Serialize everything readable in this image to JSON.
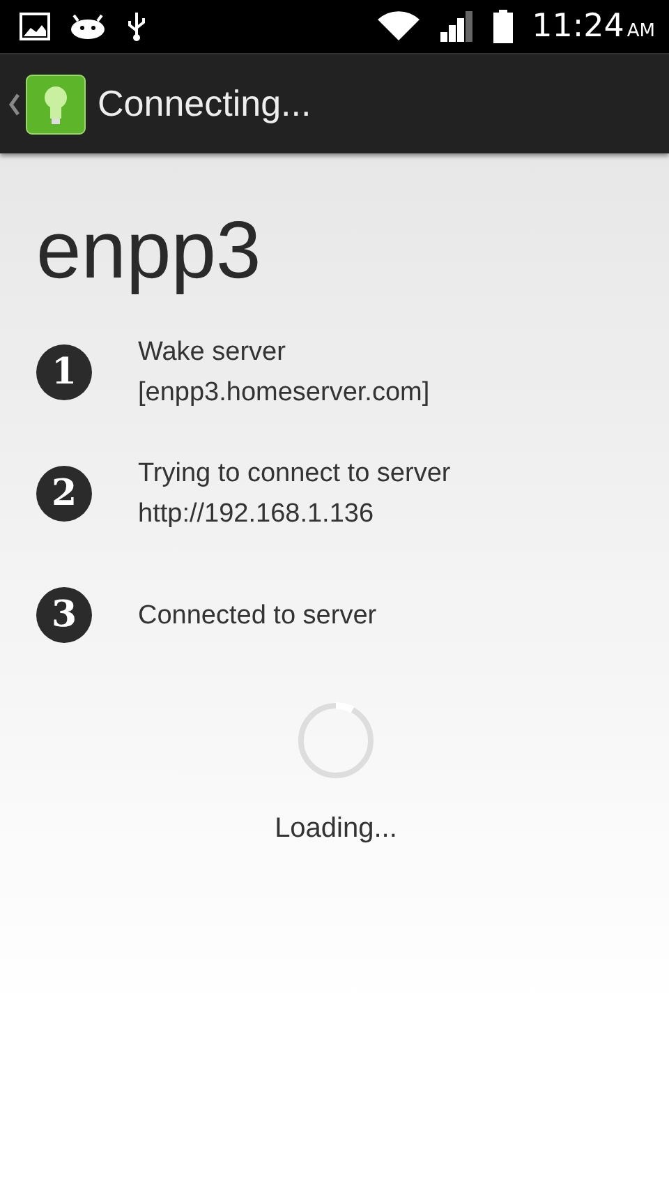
{
  "status_bar": {
    "time": "11:24",
    "meridiem": "AM"
  },
  "action_bar": {
    "title": "Connecting..."
  },
  "server_name": "enpp3",
  "steps": [
    {
      "number": "1",
      "lines": [
        "Wake server",
        "[enpp3.homeserver.com]"
      ]
    },
    {
      "number": "2",
      "lines": [
        "Trying to connect to server",
        "http://192.168.1.136"
      ]
    },
    {
      "number": "3",
      "lines": [
        "Connected to server"
      ]
    }
  ],
  "loading": {
    "label": "Loading..."
  }
}
